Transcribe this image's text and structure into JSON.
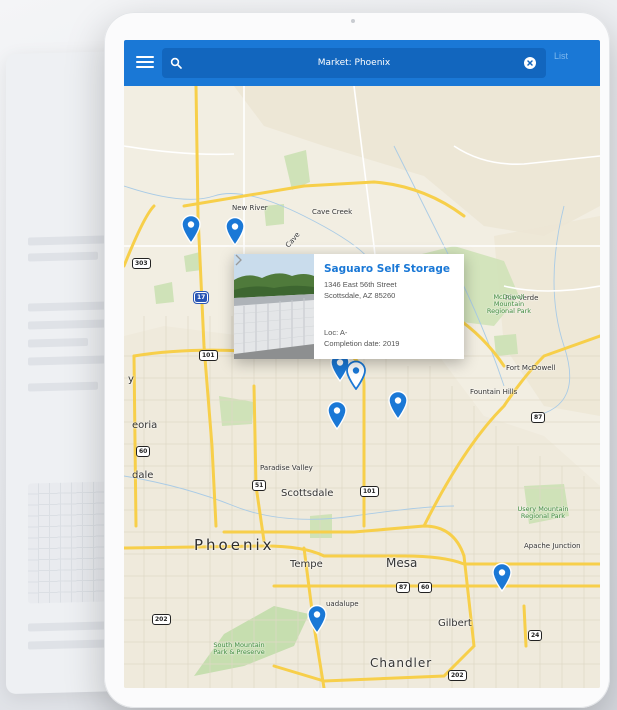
{
  "header": {
    "search_value": "Market: Phoenix",
    "list_label": "List"
  },
  "popup": {
    "title": "Saguaro Self Storage",
    "address_line1": "1346 East 56th Street",
    "address_line2": "Scottsdale, AZ 85260",
    "loc": "Loc: A-",
    "completion": "Completion date: 2019"
  },
  "map": {
    "places": {
      "new_river": "New River",
      "cave_creek": "Cave Creek",
      "rio_verde": "Rio Verde",
      "fort_mcdowell": "Fort McDowell",
      "fountain_hills": "Fountain Hills",
      "peoria": "eoria",
      "glendale": "dale",
      "paradise_valley": "Paradise Valley",
      "scottsdale": "Scottsdale",
      "phoenix": "Phoenix",
      "tempe": "Tempe",
      "mesa": "Mesa",
      "apache_junction": "Apache Junction",
      "guadalupe": "uadalupe",
      "gilbert": "Gilbert",
      "chandler": "Chandler",
      "cave_creek_fragment": "Cave",
      "y_fragment": "y"
    },
    "parks": {
      "mcdowell": "McDowell Mountain Regional Park",
      "usery": "Usery Mountain Regional Park",
      "south_mountain": "South Mountain Park & Preserve"
    },
    "shields": {
      "loop303": "303",
      "i17": "17",
      "loop101_n": "101",
      "az60_w": "60",
      "az51": "51",
      "loop101_e": "101",
      "az87_n": "87",
      "az87_s": "87",
      "us60": "60",
      "loop202_w": "202",
      "loop202_s": "202",
      "az24": "24"
    },
    "pin_color": "#1a78d6",
    "header_color": "#1a78d6"
  }
}
